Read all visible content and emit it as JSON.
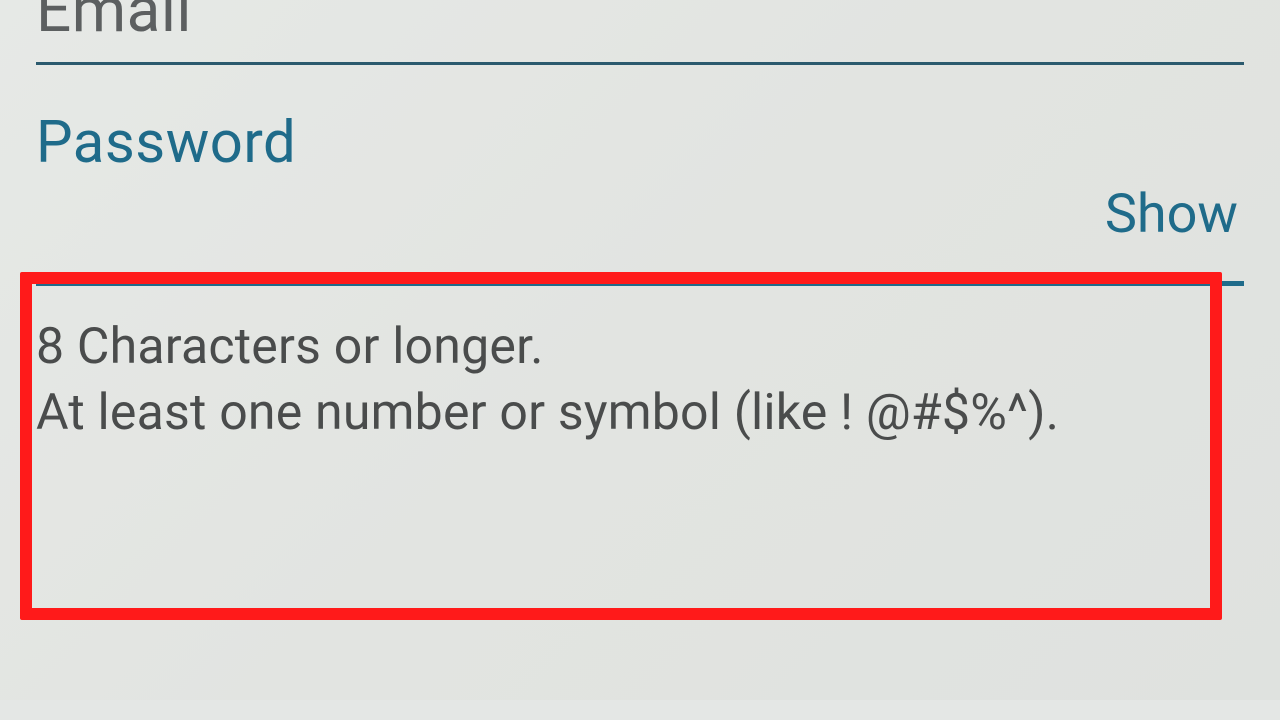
{
  "email": {
    "label": "Email"
  },
  "password": {
    "label": "Password",
    "show_label": "Show",
    "req_line1": "8 Characters or longer.",
    "req_line2": "At least one number or symbol (like ! @#$%^)."
  },
  "colors": {
    "accent": "#1f6b8a",
    "highlight": "#ff1a1a"
  }
}
